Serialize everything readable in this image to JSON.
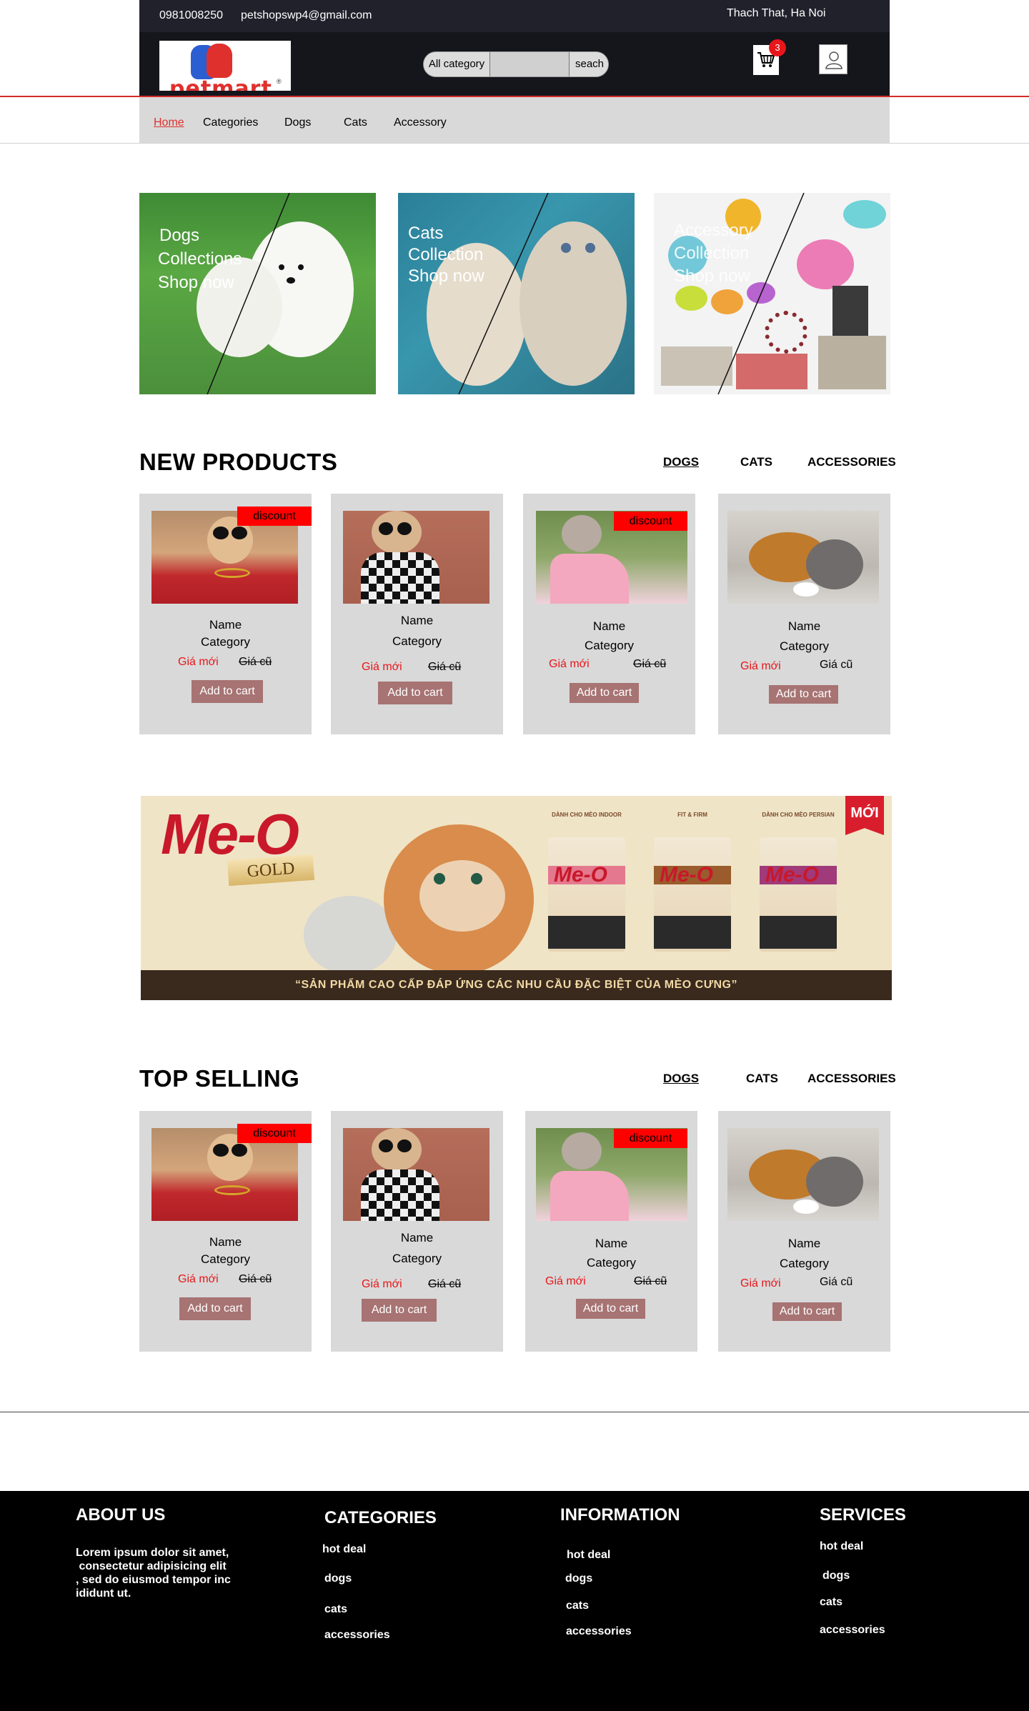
{
  "header": {
    "phone": "0981008250",
    "email": "petshopswp4@gmail.com",
    "location": "Thach That, Ha Noi",
    "logo_text": "petmart",
    "search": {
      "category_label": "All category",
      "placeholder": "",
      "button_label": "seach"
    },
    "cart_count": "3"
  },
  "nav": {
    "items": [
      "Home",
      "Categories",
      "Dogs",
      "Cats",
      "Accessory"
    ],
    "active": "Home"
  },
  "collections": [
    {
      "lines": [
        "Dogs",
        "Collections",
        "Shop now"
      ]
    },
    {
      "lines": [
        "Cats",
        "Collection",
        "Shop now"
      ]
    },
    {
      "lines": [
        "Accessory",
        "Collection",
        "Shop now"
      ]
    }
  ],
  "new_products": {
    "title": "NEW PRODUCTS",
    "tabs": [
      "DOGS",
      "CATS",
      "ACCESSORIES"
    ],
    "products": [
      {
        "badge": "discount",
        "name": "Name",
        "category": "Category",
        "price_new": "Giá mới",
        "price_old": "Giá cũ",
        "old_struck": true,
        "button": "Add to cart"
      },
      {
        "badge": "",
        "name": "Name",
        "category": "Category",
        "price_new": "Giá mới",
        "price_old": "Giá cũ",
        "old_struck": true,
        "button": "Add to cart"
      },
      {
        "badge": "discount",
        "name": "Name",
        "category": "Category",
        "price_new": "Giá mới",
        "price_old": "Giá cũ",
        "old_struck": true,
        "button": "Add to cart"
      },
      {
        "badge": "",
        "name": "Name",
        "category": "Category",
        "price_new": "Giá mới",
        "price_old": "Giá cũ",
        "old_struck": false,
        "button": "Add to cart"
      }
    ]
  },
  "banner": {
    "brand": "Me-O",
    "sub": "GOLD",
    "tag": "MỚI",
    "slogan": "“SẢN PHẨM CAO CẤP ĐÁP ỨNG  CÁC NHU CẦU ĐẶC BIỆT CỦA MÈO CƯNG”",
    "bags": [
      "DÀNH CHO MÈO INDOOR",
      "FIT & FIRM",
      "DÀNH CHO MÈO PERSIAN"
    ]
  },
  "top_selling": {
    "title": "TOP SELLING",
    "tabs": [
      "DOGS",
      "CATS",
      "ACCESSORIES"
    ],
    "products": [
      {
        "badge": "discount",
        "name": "Name",
        "category": "Category",
        "price_new": "Giá mới",
        "price_old": "Giá cũ",
        "old_struck": true,
        "button": "Add to cart"
      },
      {
        "badge": "",
        "name": "Name",
        "category": "Category",
        "price_new": "Giá mới",
        "price_old": "Giá cũ",
        "old_struck": true,
        "button": "Add to cart"
      },
      {
        "badge": "discount",
        "name": "Name",
        "category": "Category",
        "price_new": "Giá mới",
        "price_old": "Giá cũ",
        "old_struck": true,
        "button": "Add to cart"
      },
      {
        "badge": "",
        "name": "Name",
        "category": "Category",
        "price_new": "Giá mới",
        "price_old": "Giá cũ",
        "old_struck": false,
        "button": "Add to cart"
      }
    ]
  },
  "footer": {
    "about": {
      "title": "ABOUT US",
      "lines": [
        "Lorem ipsum dolor sit amet,",
        " consectetur adipisicing elit",
        ", sed do eiusmod tempor inc",
        "ididunt ut."
      ]
    },
    "categories": {
      "title": "CATEGORIES",
      "links": [
        "hot deal",
        "dogs",
        "cats",
        "accessories"
      ]
    },
    "information": {
      "title": "INFORMATION",
      "links": [
        "hot deal",
        "dogs",
        "cats",
        "accessories"
      ]
    },
    "services": {
      "title": "SERVICES",
      "links": [
        "hot deal",
        "dogs",
        "cats",
        "accessories"
      ]
    }
  },
  "colors": {
    "accent_red": "#e8161a",
    "header_dark": "#15151c",
    "card_bg": "#d9d9d9",
    "cart_button": "#a77373"
  }
}
